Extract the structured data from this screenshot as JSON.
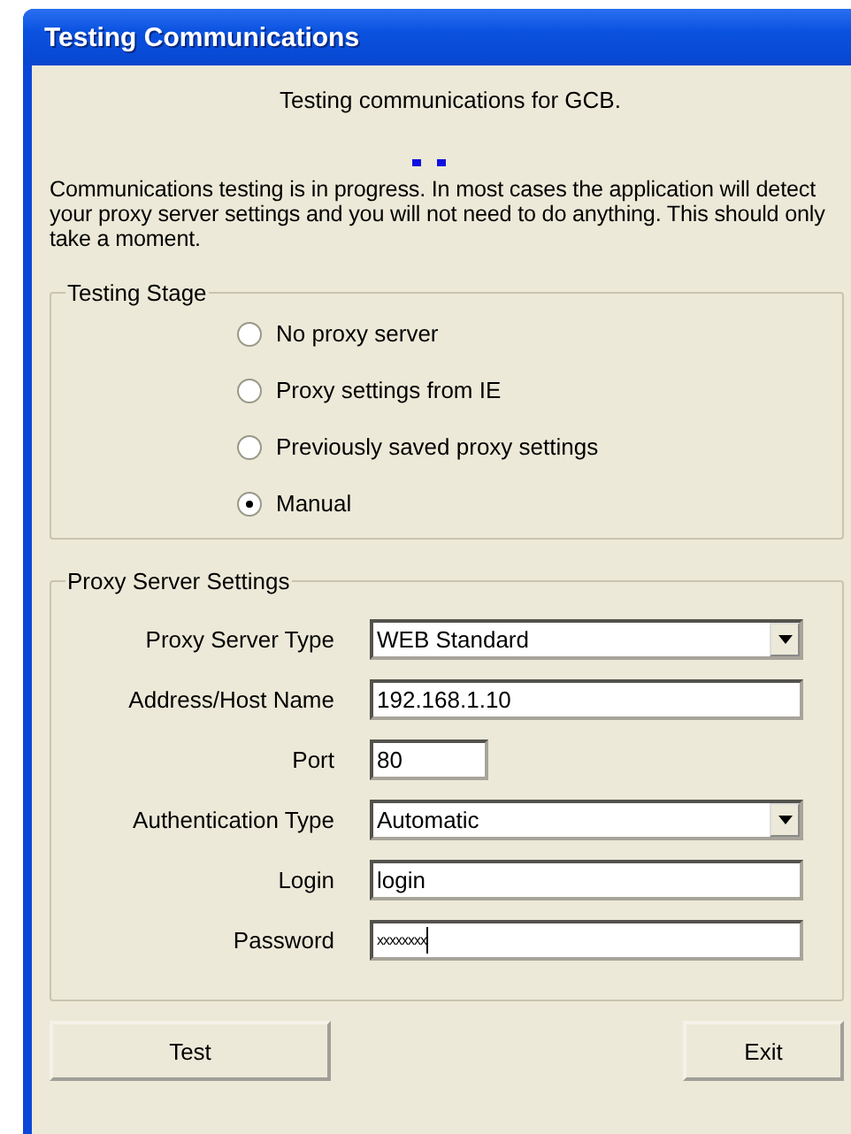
{
  "window": {
    "title": "Testing Communications"
  },
  "heading": "Testing communications for GCB.",
  "message": "Communications testing is in progress.  In most cases the application will detect your proxy server settings and you will not need to do anything.  This should only take a moment.",
  "testing_stage": {
    "title": "Testing Stage",
    "options": [
      {
        "label": "No proxy server",
        "selected": false
      },
      {
        "label": "Proxy settings from IE",
        "selected": false
      },
      {
        "label": "Previously saved proxy settings",
        "selected": false
      },
      {
        "label": "Manual",
        "selected": true
      }
    ]
  },
  "proxy_settings": {
    "title": "Proxy Server Settings",
    "fields": [
      {
        "label": "Proxy Server Type",
        "kind": "dropdown",
        "value": "WEB Standard"
      },
      {
        "label": "Address/Host Name",
        "kind": "text",
        "value": "192.168.1.10"
      },
      {
        "label": "Port",
        "kind": "short",
        "value": "80"
      },
      {
        "label": "Authentication Type",
        "kind": "dropdown",
        "value": "Automatic"
      },
      {
        "label": "Login",
        "kind": "text",
        "value": "login"
      },
      {
        "label": "Password",
        "kind": "password",
        "value": "xxxxxxxx"
      }
    ]
  },
  "buttons": [
    {
      "label": "Test"
    },
    {
      "label": "Exit"
    }
  ]
}
